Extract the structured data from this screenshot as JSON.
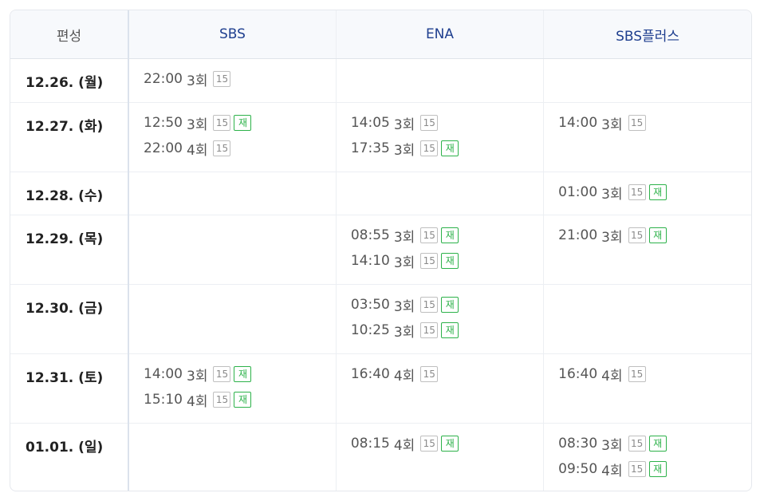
{
  "header": {
    "corner": "편성",
    "channels": [
      "SBS",
      "ENA",
      "SBS플러스"
    ]
  },
  "badges": {
    "rating": "15",
    "rerun": "재"
  },
  "colors": {
    "channel_text": "#1f3f8f",
    "rerun_badge": "#2db24a",
    "rating_badge": "#8a8a8a"
  },
  "rows": [
    {
      "date": "12.26. (월)",
      "cells": [
        [
          {
            "time": "22:00",
            "ep": "3회",
            "rating": true,
            "rerun": false
          }
        ],
        [],
        []
      ]
    },
    {
      "date": "12.27. (화)",
      "cells": [
        [
          {
            "time": "12:50",
            "ep": "3회",
            "rating": true,
            "rerun": true
          },
          {
            "time": "22:00",
            "ep": "4회",
            "rating": true,
            "rerun": false
          }
        ],
        [
          {
            "time": "14:05",
            "ep": "3회",
            "rating": true,
            "rerun": false
          },
          {
            "time": "17:35",
            "ep": "3회",
            "rating": true,
            "rerun": true
          }
        ],
        [
          {
            "time": "14:00",
            "ep": "3회",
            "rating": true,
            "rerun": false
          }
        ]
      ]
    },
    {
      "date": "12.28. (수)",
      "cells": [
        [],
        [],
        [
          {
            "time": "01:00",
            "ep": "3회",
            "rating": true,
            "rerun": true
          }
        ]
      ]
    },
    {
      "date": "12.29. (목)",
      "cells": [
        [],
        [
          {
            "time": "08:55",
            "ep": "3회",
            "rating": true,
            "rerun": true
          },
          {
            "time": "14:10",
            "ep": "3회",
            "rating": true,
            "rerun": true
          }
        ],
        [
          {
            "time": "21:00",
            "ep": "3회",
            "rating": true,
            "rerun": true
          }
        ]
      ]
    },
    {
      "date": "12.30. (금)",
      "cells": [
        [],
        [
          {
            "time": "03:50",
            "ep": "3회",
            "rating": true,
            "rerun": true
          },
          {
            "time": "10:25",
            "ep": "3회",
            "rating": true,
            "rerun": true
          }
        ],
        []
      ]
    },
    {
      "date": "12.31. (토)",
      "cells": [
        [
          {
            "time": "14:00",
            "ep": "3회",
            "rating": true,
            "rerun": true
          },
          {
            "time": "15:10",
            "ep": "4회",
            "rating": true,
            "rerun": true
          }
        ],
        [
          {
            "time": "16:40",
            "ep": "4회",
            "rating": true,
            "rerun": false
          }
        ],
        [
          {
            "time": "16:40",
            "ep": "4회",
            "rating": true,
            "rerun": false
          }
        ]
      ]
    },
    {
      "date": "01.01. (일)",
      "cells": [
        [],
        [
          {
            "time": "08:15",
            "ep": "4회",
            "rating": true,
            "rerun": true
          }
        ],
        [
          {
            "time": "08:30",
            "ep": "3회",
            "rating": true,
            "rerun": true
          },
          {
            "time": "09:50",
            "ep": "4회",
            "rating": true,
            "rerun": true
          }
        ]
      ]
    }
  ]
}
